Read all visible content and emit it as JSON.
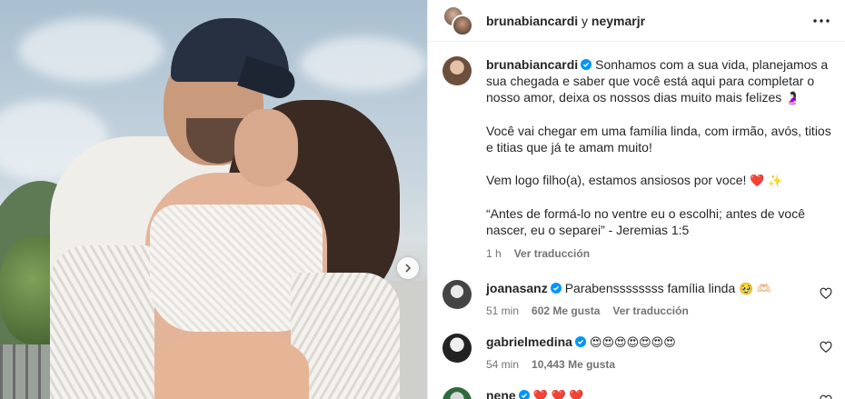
{
  "header": {
    "user1": "brunabiancardi",
    "connector": "y",
    "user2": "neymarjr"
  },
  "caption": {
    "username": "brunabiancardi",
    "text1": "Sonhamos com a sua vida, planejamos a sua chegada e saber que você está aqui para completar o nosso amor, deixa os nossos dias muito mais felizes",
    "emoji1": "🤰🏻",
    "text2": "Você vai chegar em uma família linda, com irmão, avós, titios e titias que já te amam muito!",
    "text3": "Vem logo filho(a), estamos ansiosos por voce!",
    "emoji3": "❤️ ✨",
    "text4": "“Antes de formá-lo no ventre eu o escolhi; antes de você nascer, eu o separei” - Jeremias 1:5",
    "time": "1 h",
    "translate": "Ver traducción"
  },
  "comments": [
    {
      "username": "joanasanz",
      "text": "Parabenssssssss família linda",
      "emoji": "🥹 🫶🏻",
      "time": "51 min",
      "likes": "602 Me gusta",
      "translate": "Ver traducción"
    },
    {
      "username": "gabrielmedina",
      "text": "",
      "emoji": "😍😍😍😍😍😍😍",
      "time": "54 min",
      "likes": "10,443 Me gusta",
      "translate": ""
    },
    {
      "username": "nene",
      "text": "",
      "emoji": "❤️ ❤️ ❤️",
      "time": "",
      "likes": "",
      "translate": ""
    }
  ],
  "icons": {
    "verified_color": "#0095f6",
    "more": "more-horizontal-icon",
    "heart": "heart-outline-icon",
    "carousel": "chevron-right-icon"
  }
}
